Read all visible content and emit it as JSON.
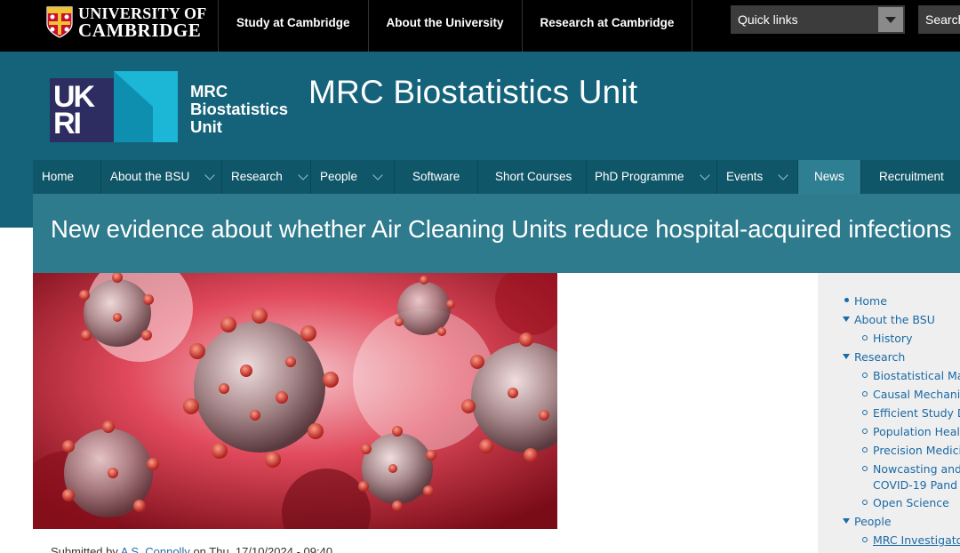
{
  "topbar": {
    "logo_line1": "UNIVERSITY OF",
    "logo_line2": "CAMBRIDGE",
    "links": [
      "Study at Cambridge",
      "About the University",
      "Research at Cambridge"
    ],
    "quicklinks_label": "Quick links",
    "search_label": "Search"
  },
  "header": {
    "mrc_line1": "MRC",
    "mrc_line2": "Biostatistics",
    "mrc_line3": "Unit",
    "site_title": "MRC Biostatistics Unit",
    "colors": {
      "teal": "#14637a",
      "nav": "#0f5668",
      "active": "#2f7f92",
      "title_band": "#2d7b8d"
    }
  },
  "mainnav": {
    "items": [
      {
        "label": "Home",
        "dropdown": false
      },
      {
        "label": "About the BSU",
        "dropdown": true
      },
      {
        "label": "Research",
        "dropdown": true
      },
      {
        "label": "People",
        "dropdown": true
      },
      {
        "label": "Software",
        "dropdown": false
      },
      {
        "label": "Short Courses",
        "dropdown": false
      },
      {
        "label": "PhD Programme",
        "dropdown": true
      },
      {
        "label": "Events",
        "dropdown": true
      },
      {
        "label": "News",
        "dropdown": false,
        "active": true
      },
      {
        "label": "Recruitment",
        "dropdown": false
      }
    ]
  },
  "page": {
    "title": "New evidence about whether Air Cleaning Units reduce hospital-acquired infections",
    "submitted_prefix": "Submitted by",
    "author": "A S. Connolly",
    "submitted_date": "on Thu, 17/10/2024 - 09:40"
  },
  "sidebar": {
    "items": [
      {
        "label": "Home",
        "level": 0,
        "type": "bullet"
      },
      {
        "label": "About the BSU",
        "level": 0,
        "type": "expanded"
      },
      {
        "label": "History",
        "level": 1,
        "type": "ring"
      },
      {
        "label": "Research",
        "level": 0,
        "type": "expanded"
      },
      {
        "label": "Biostatistical Ma",
        "level": 1,
        "type": "ring"
      },
      {
        "label": "Causal Mechani",
        "level": 1,
        "type": "ring"
      },
      {
        "label": "Efficient Study D",
        "level": 1,
        "type": "ring"
      },
      {
        "label": "Population Heal",
        "level": 1,
        "type": "ring"
      },
      {
        "label": "Precision Medici",
        "level": 1,
        "type": "ring"
      },
      {
        "label": "Nowcasting and",
        "label2": "COVID-19 Pand",
        "level": 1,
        "type": "ring"
      },
      {
        "label": "Open Science",
        "level": 1,
        "type": "ring"
      },
      {
        "label": "People",
        "level": 0,
        "type": "expanded"
      },
      {
        "label": "MRC Investigato",
        "level": 1,
        "type": "ring",
        "underline": true
      }
    ]
  }
}
